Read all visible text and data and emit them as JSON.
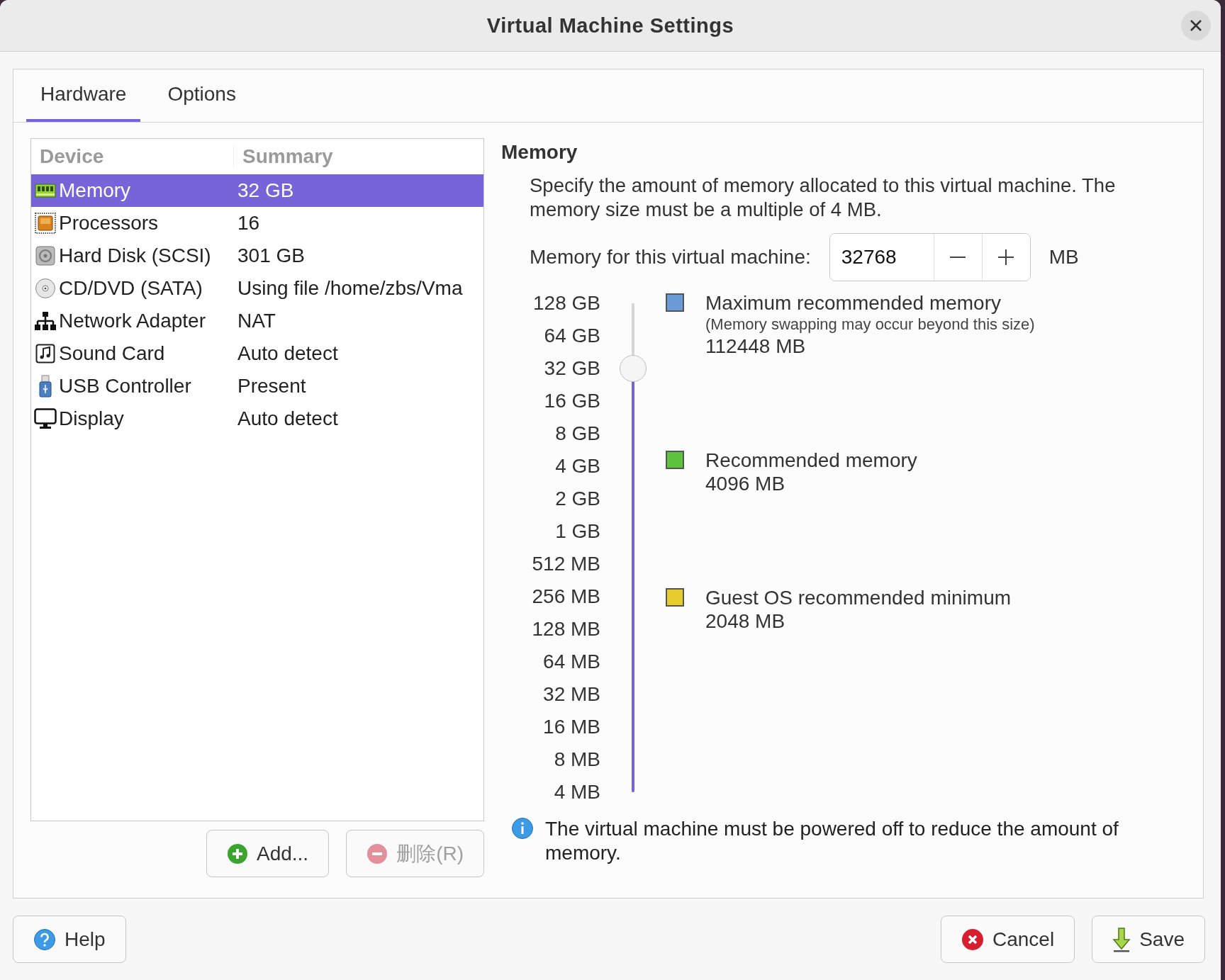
{
  "window": {
    "title": "Virtual Machine Settings"
  },
  "tabs": [
    {
      "label": "Hardware",
      "selected": true
    },
    {
      "label": "Options",
      "selected": false
    }
  ],
  "device_list": {
    "columns": [
      "Device",
      "Summary"
    ],
    "rows": [
      {
        "kind": "memory",
        "device": "Memory",
        "summary": "32 GB",
        "selected": true
      },
      {
        "kind": "processor",
        "device": "Processors",
        "summary": "16",
        "selected": false
      },
      {
        "kind": "disk",
        "device": "Hard Disk (SCSI)",
        "summary": "301 GB",
        "selected": false
      },
      {
        "kind": "cd",
        "device": "CD/DVD (SATA)",
        "summary": "Using file /home/zbs/Vma",
        "selected": false
      },
      {
        "kind": "network",
        "device": "Network Adapter",
        "summary": "NAT",
        "selected": false
      },
      {
        "kind": "sound",
        "device": "Sound Card",
        "summary": "Auto detect",
        "selected": false
      },
      {
        "kind": "usb",
        "device": "USB Controller",
        "summary": "Present",
        "selected": false
      },
      {
        "kind": "display",
        "device": "Display",
        "summary": "Auto detect",
        "selected": false
      }
    ]
  },
  "list_buttons": [
    {
      "kind": "add",
      "label": "Add...",
      "disabled": false
    },
    {
      "kind": "remove",
      "label": "删除(R)",
      "disabled": true
    }
  ],
  "memory": {
    "heading": "Memory",
    "description": "Specify the amount of memory allocated to this virtual machine. The memory size must be a multiple of 4 MB.",
    "field_label": "Memory for this virtual machine:",
    "value": "32768",
    "unit": "MB",
    "scale": [
      "128 GB",
      "64 GB",
      "32 GB",
      "16 GB",
      "8 GB",
      "4 GB",
      "2 GB",
      "1 GB",
      "512 MB",
      "256 MB",
      "128 MB",
      "64 MB",
      "32 MB",
      "16 MB",
      "8 MB",
      "4 MB"
    ],
    "slider": {
      "level": 0.867
    },
    "legend": [
      {
        "color": "#6b9bd6",
        "title": "Maximum recommended memory",
        "note": "(Memory swapping may occur beyond this size)",
        "value": "112448 MB"
      },
      {
        "color": "#5cc43c",
        "title": "Recommended memory",
        "value": "4096 MB"
      },
      {
        "color": "#e6cc2e",
        "title": "Guest OS recommended minimum",
        "value": "2048 MB"
      }
    ],
    "info": "The virtual machine must be powered off to reduce the amount of memory."
  },
  "footer_buttons": [
    {
      "kind": "help",
      "label": "Help"
    },
    {
      "kind": "cancel",
      "label": "Cancel"
    },
    {
      "kind": "save",
      "label": "Save"
    }
  ]
}
